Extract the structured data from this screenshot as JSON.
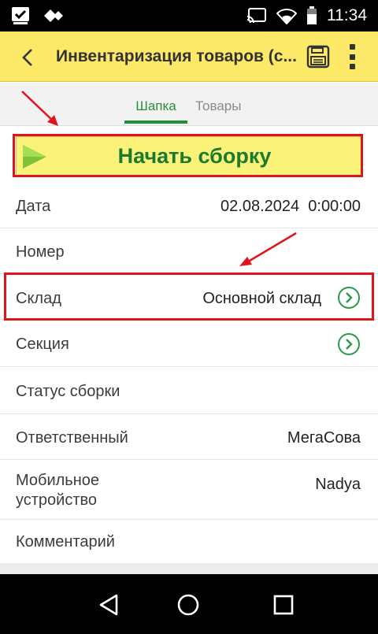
{
  "status_bar": {
    "time": "11:34",
    "icons": [
      "checkbox-notification-icon",
      "diamond-arrows-icon",
      "cast-icon",
      "wifi-icon",
      "battery-icon"
    ]
  },
  "header": {
    "title": "Инвентаризация товаров (с...",
    "back_icon": "back-chevron-icon",
    "save_icon": "floppy-disk-icon",
    "menu_icon": "kebab-menu-icon"
  },
  "tabs": [
    {
      "label": "Шапка",
      "active": true
    },
    {
      "label": "Товары",
      "active": false
    }
  ],
  "start_button": {
    "label": "Начать сборку",
    "icon": "play-triangle-icon"
  },
  "fields": [
    {
      "label": "Дата",
      "value": "02.08.2024  0:00:00"
    },
    {
      "label": "Номер",
      "value": ""
    },
    {
      "label": "Склад",
      "value": "Основной склад",
      "has_chevron": true
    },
    {
      "label": "Секция",
      "value": "",
      "has_chevron": true
    },
    {
      "label": "Статус сборки",
      "value": ""
    },
    {
      "label": "Ответственный",
      "value": "МегаСова"
    },
    {
      "label": "Мобильное устройство",
      "label_lines": [
        "Мобильное",
        "устройство"
      ],
      "value": "Nadya"
    },
    {
      "label": "Комментарий",
      "value": ""
    }
  ],
  "colors": {
    "header_bg": "#fbe967",
    "start_bg": "#fbf27a",
    "accent_green": "#1f8f3a",
    "annotation_red": "#e0141c"
  },
  "nav_bar": {
    "icons": [
      "back-triangle-icon",
      "home-circle-icon",
      "recents-square-icon"
    ]
  }
}
